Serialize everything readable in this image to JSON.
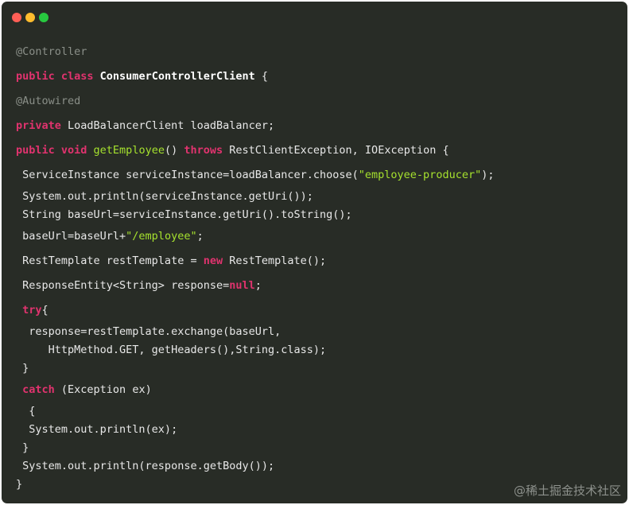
{
  "window": {
    "controls": [
      "close-icon",
      "minimize-icon",
      "maximize-icon"
    ],
    "colors": {
      "background": "#282c26",
      "keyword": "#e0336e",
      "annotation": "#8a8f88",
      "string": "#a6e22e",
      "text": "#e8e8e8"
    }
  },
  "code": {
    "language": "java",
    "lines": [
      [
        {
          "t": "ann",
          "v": "@Controller"
        }
      ],
      [
        {
          "t": "kw",
          "v": "public class "
        },
        {
          "t": "type",
          "v": "ConsumerControllerClient"
        },
        {
          "t": "plain",
          "v": " {"
        }
      ],
      [
        {
          "t": "ann",
          "v": "@Autowired"
        }
      ],
      [
        {
          "t": "kw",
          "v": "private"
        },
        {
          "t": "plain",
          "v": " LoadBalancerClient loadBalancer;"
        }
      ],
      [
        {
          "t": "kw",
          "v": "public void "
        },
        {
          "t": "fn",
          "v": "getEmployee"
        },
        {
          "t": "plain",
          "v": "() "
        },
        {
          "t": "kw",
          "v": "throws"
        },
        {
          "t": "plain",
          "v": " RestClientException, IOException {"
        }
      ],
      [
        {
          "t": "plain",
          "v": " ServiceInstance serviceInstance=loadBalancer.choose("
        },
        {
          "t": "str",
          "v": "\"employee-producer\""
        },
        {
          "t": "plain",
          "v": ");"
        }
      ],
      [
        {
          "t": "plain",
          "v": " System.out.println(serviceInstance.getUri());"
        }
      ],
      [
        {
          "t": "plain",
          "v": " String baseUrl=serviceInstance.getUri().toString();"
        }
      ],
      [
        {
          "t": "plain",
          "v": " baseUrl=baseUrl+"
        },
        {
          "t": "str",
          "v": "\"/employee\""
        },
        {
          "t": "plain",
          "v": ";"
        }
      ],
      [
        {
          "t": "plain",
          "v": " RestTemplate restTemplate = "
        },
        {
          "t": "kw",
          "v": "new"
        },
        {
          "t": "plain",
          "v": " RestTemplate();"
        }
      ],
      [
        {
          "t": "plain",
          "v": " ResponseEntity<String> response="
        },
        {
          "t": "kw",
          "v": "null"
        },
        {
          "t": "plain",
          "v": ";"
        }
      ],
      [
        {
          "t": "plain",
          "v": " "
        },
        {
          "t": "kw",
          "v": "try"
        },
        {
          "t": "plain",
          "v": "{"
        }
      ],
      [
        {
          "t": "plain",
          "v": "  response=restTemplate.exchange(baseUrl,"
        }
      ],
      [
        {
          "t": "plain",
          "v": "     HttpMethod.GET, getHeaders(),String.class);"
        }
      ],
      [
        {
          "t": "plain",
          "v": " }"
        }
      ],
      [
        {
          "t": "plain",
          "v": " "
        },
        {
          "t": "kw",
          "v": "catch"
        },
        {
          "t": "plain",
          "v": " (Exception ex)"
        }
      ],
      [
        {
          "t": "plain",
          "v": "  {"
        }
      ],
      [
        {
          "t": "plain",
          "v": "  System.out.println(ex);"
        }
      ],
      [
        {
          "t": "plain",
          "v": " }"
        }
      ],
      [
        {
          "t": "plain",
          "v": " System.out.println(response.getBody());"
        }
      ],
      [
        {
          "t": "plain",
          "v": "}"
        }
      ]
    ]
  },
  "watermark": "@稀土掘金技术社区"
}
